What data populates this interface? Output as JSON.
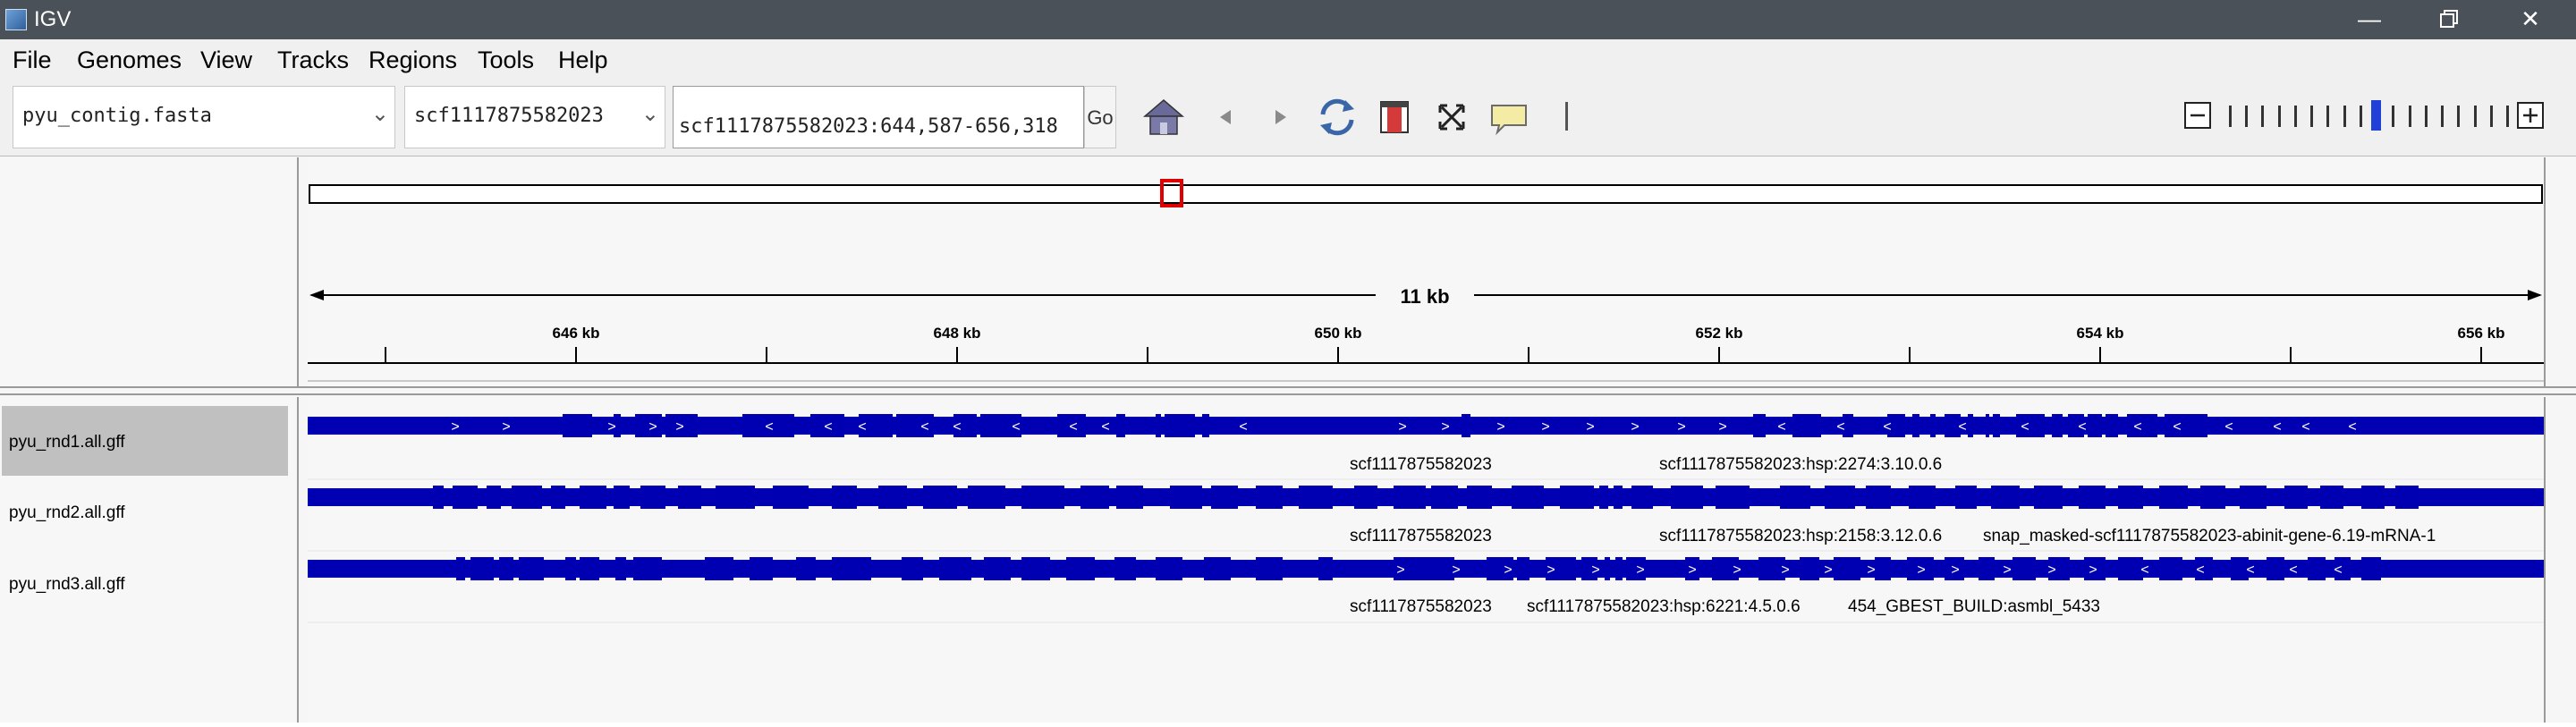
{
  "window": {
    "title": "IGV",
    "controls": [
      "minimize",
      "restore",
      "close"
    ]
  },
  "menubar": {
    "items": [
      "File",
      "Genomes",
      "View",
      "Tracks",
      "Regions",
      "Tools",
      "Help"
    ]
  },
  "toolbar": {
    "genome_select": "pyu_contig.fasta",
    "chromosome_select": "scf1117875582023",
    "locus": "scf1117875582023:644,587-656,318",
    "go_label": "Go",
    "icons": [
      "home-icon",
      "back-icon",
      "forward-icon",
      "refresh-icon",
      "roi-icon",
      "resize-icon",
      "popup-text-icon"
    ],
    "zoom_level_fraction": 0.55
  },
  "ruler": {
    "span_label": "11 kb",
    "ticks": [
      "646 kb",
      "648 kb",
      "650 kb",
      "652 kb",
      "654 kb",
      "656 kb"
    ]
  },
  "tracks": [
    {
      "name": "pyu_rnd1.all.gff",
      "selected": true,
      "features": [
        "scf1117875582023",
        "scf1117875582023:hsp:2274:3.10.0.6"
      ]
    },
    {
      "name": "pyu_rnd2.all.gff",
      "selected": false,
      "features": [
        "scf1117875582023",
        "scf1117875582023:hsp:2158:3.12.0.6",
        "snap_masked-scf1117875582023-abinit-gene-6.19-mRNA-1"
      ]
    },
    {
      "name": "pyu_rnd3.all.gff",
      "selected": false,
      "features": [
        "scf1117875582023",
        "scf1117875582023:hsp:6221:4.5.0.6",
        "454_GBEST_BUILD:asmbl_5433"
      ]
    }
  ],
  "colors": {
    "feature": "#0000b2",
    "titlebar": "#4a5158",
    "region_marker": "#e00000"
  }
}
